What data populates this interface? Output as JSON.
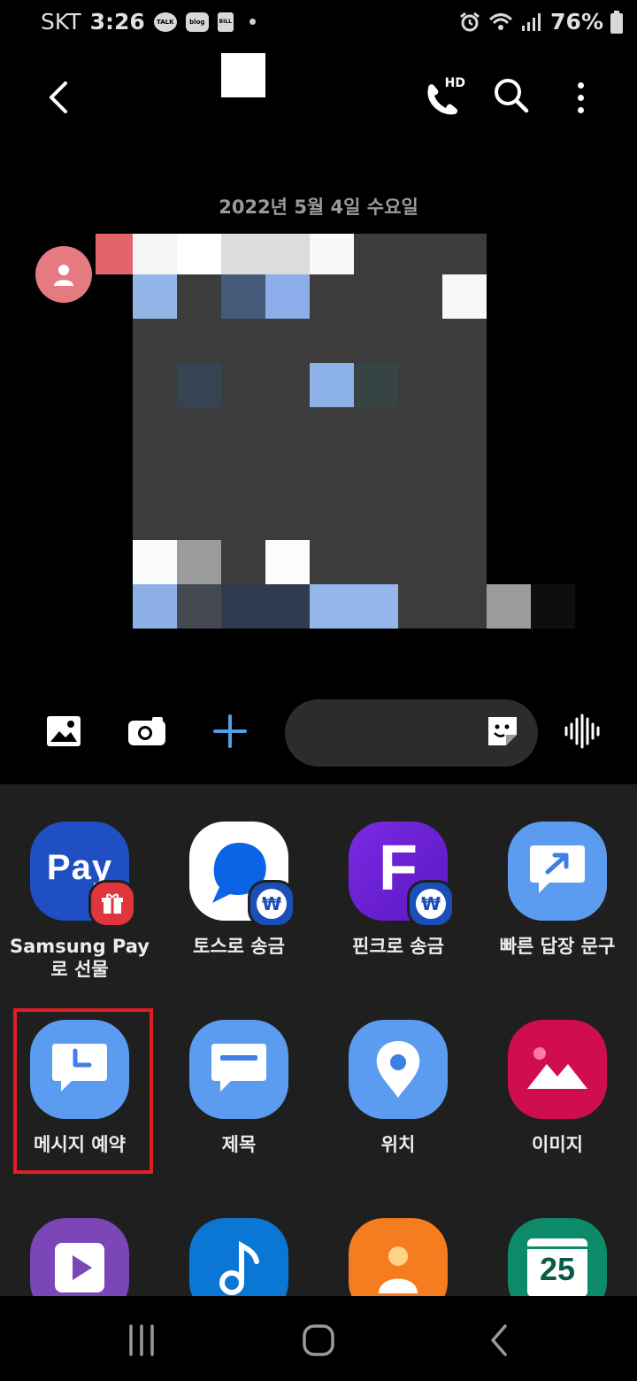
{
  "status_bar": {
    "carrier": "SKT",
    "time": "3:26",
    "notifications": [
      "TALK",
      "blog",
      "BILL"
    ],
    "battery": "76%"
  },
  "top_bar": {
    "call_badge": "HD"
  },
  "conversation": {
    "date_separator": "2022년 5월 4일 수요일"
  },
  "compose": {
    "message_placeholder": ""
  },
  "panel": {
    "apps": [
      {
        "label": "Samsung Pay로 선물",
        "icon_text": "Pay"
      },
      {
        "label": "토스로 송금"
      },
      {
        "label": "핀크로 송금",
        "icon_text": "F"
      },
      {
        "label": "빠른 답장 문구"
      },
      {
        "label": "메시지 예약"
      },
      {
        "label": "제목"
      },
      {
        "label": "위치"
      },
      {
        "label": "이미지"
      },
      {
        "label": ""
      },
      {
        "label": ""
      },
      {
        "label": ""
      },
      {
        "label": "",
        "icon_text": "25"
      }
    ],
    "won_sign": "₩"
  },
  "colors": {
    "accent_blue": "#4d9fe6",
    "highlight_red": "#e01e26",
    "avatar_pink": "#e57b80"
  }
}
